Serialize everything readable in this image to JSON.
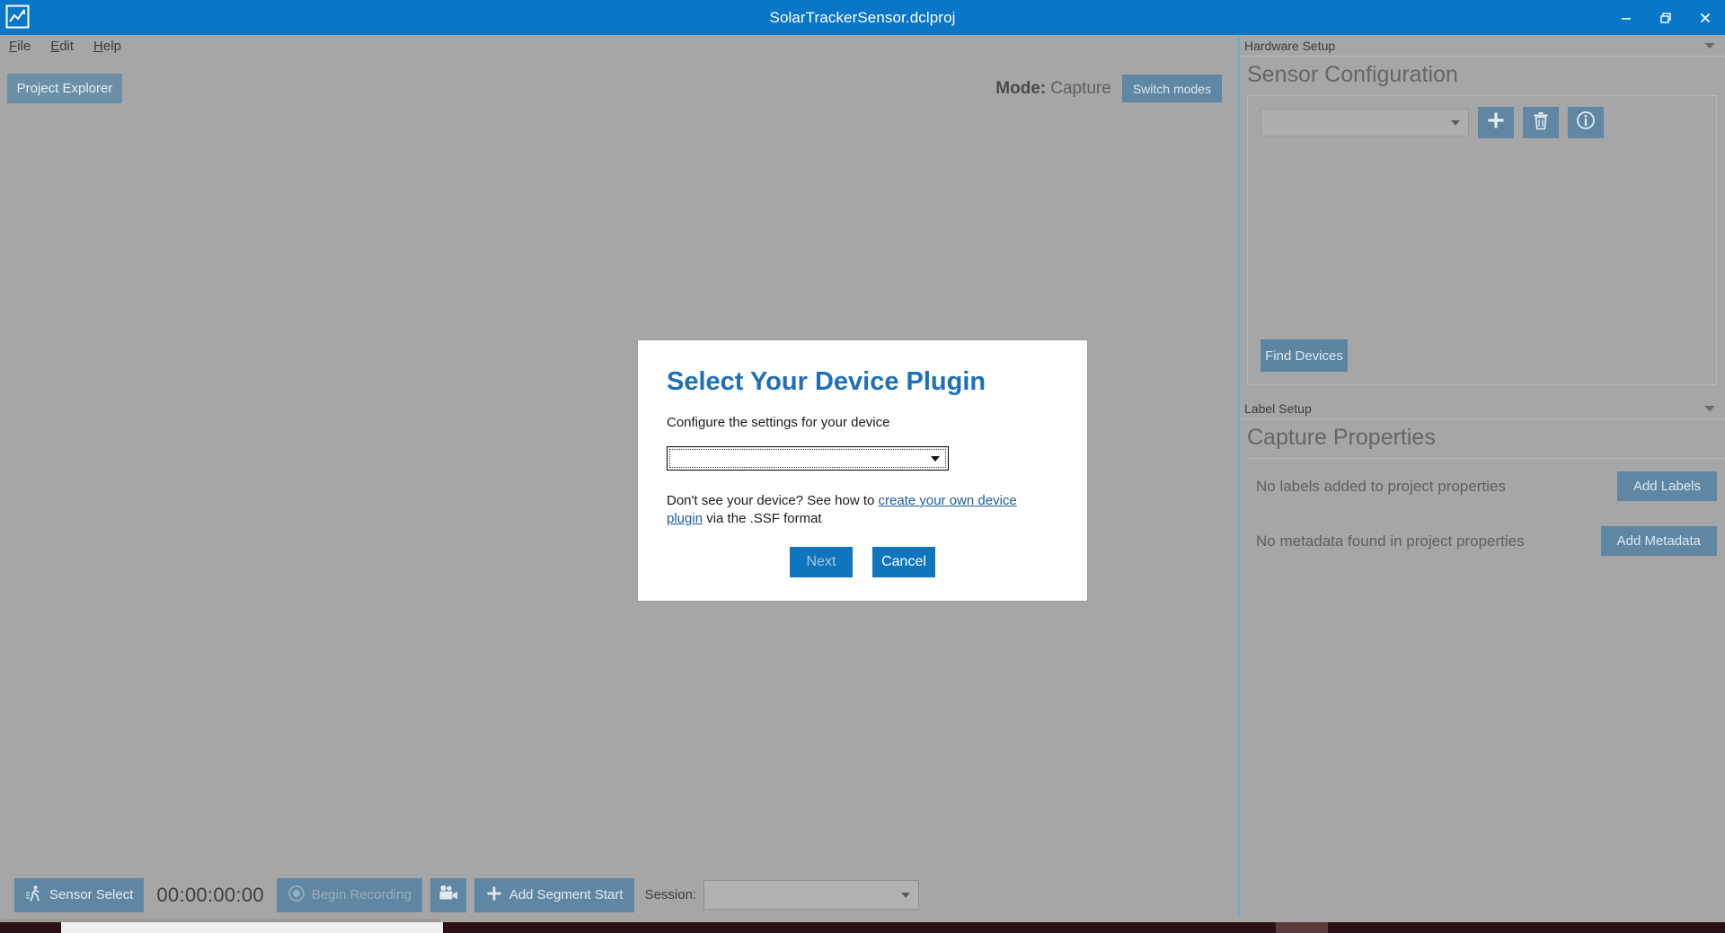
{
  "window": {
    "title": "SolarTrackerSensor.dclproj",
    "logo_icon": "chart-line-logo-icon",
    "minimize_label": "Minimize",
    "restore_label": "Restore",
    "close_label": "Close",
    "accent_color": "#0a76c8"
  },
  "menubar": {
    "items": [
      {
        "label": "File",
        "accel": "F"
      },
      {
        "label": "Edit",
        "accel": "E"
      },
      {
        "label": "Help",
        "accel": "H"
      }
    ]
  },
  "toolbar": {
    "project_explorer_label": "Project Explorer",
    "mode_label": "Mode:",
    "mode_value": "Capture",
    "switch_modes_label": "Switch modes"
  },
  "dialog": {
    "title": "Select Your Device Plugin",
    "subtitle": "Configure the settings for your device",
    "combo_value": "",
    "combo_placeholder": "",
    "help_prefix": "Don't see your device? See how to ",
    "help_link": "create your own device plugin",
    "help_suffix": " via the .SSF format",
    "next_label": "Next",
    "cancel_label": "Cancel",
    "title_color": "#1d6fb8",
    "button_color": "#0f75bd"
  },
  "right_panel": {
    "hardware_setup": {
      "section_label": "Hardware Setup",
      "panel_title": "Sensor Configuration",
      "sensor_combo_value": "",
      "add_button_icon": "plus-icon",
      "delete_button_icon": "trash-icon",
      "info_button_icon": "info-icon",
      "find_devices_label": "Find Devices"
    },
    "label_setup": {
      "section_label": "Label Setup",
      "panel_title": "Capture Properties",
      "labels_empty_text": "No labels added to project properties",
      "add_labels_label": "Add Labels",
      "metadata_empty_text": "No metadata found in project properties",
      "add_metadata_label": "Add Metadata"
    }
  },
  "bottom_bar": {
    "sensor_select_label": "Sensor Select",
    "sensor_select_icon": "walking-person-icon",
    "timecode": "00:00:00:00",
    "begin_recording_label": "Begin Recording",
    "begin_recording_icon": "record-circle-icon",
    "camera_button_icon": "video-camera-icon",
    "add_segment_label": "Add Segment Start",
    "add_segment_icon": "plus-icon",
    "session_label": "Session:",
    "session_value": ""
  }
}
